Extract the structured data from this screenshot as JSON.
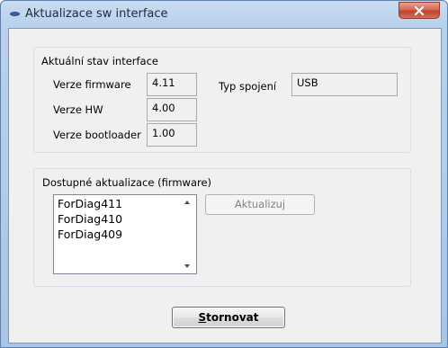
{
  "window": {
    "title": "Aktualizace sw interface",
    "app_icon": "oval-app-icon",
    "close_icon": "close-icon"
  },
  "status_group": {
    "title": "Aktuální stav interface",
    "firmware_label": "Verze firmware",
    "firmware_value": "4.11",
    "hw_label": "Verze HW",
    "hw_value": "4.00",
    "bootloader_label": "Verze bootloader",
    "bootloader_value": "1.00",
    "connection_label": "Typ spojení",
    "connection_value": "USB"
  },
  "updates_group": {
    "title": "Dostupné aktualizace (firmware)",
    "items": [
      "ForDiag411",
      "ForDiag410",
      "ForDiag409"
    ],
    "update_button": "Aktualizuj"
  },
  "cancel_button": {
    "hotkey": "S",
    "rest": "tornovat"
  },
  "colors": {
    "close_button": "#c7452d",
    "title_bar": "#b9d1ec",
    "client_bg": "#f0f0f0"
  }
}
